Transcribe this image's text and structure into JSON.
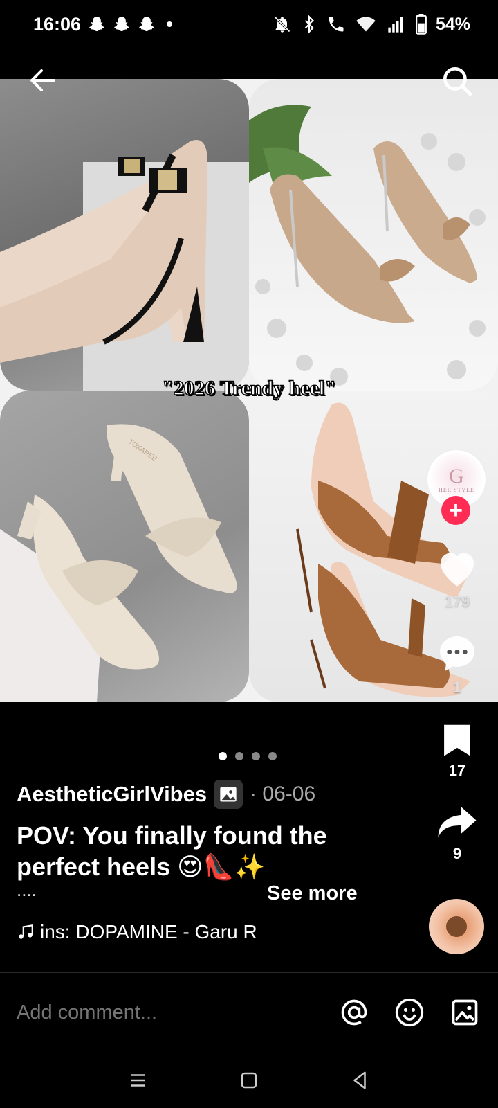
{
  "status_bar": {
    "time": "16:06",
    "battery": "54%",
    "icons": [
      "snapchat-ghost-icon",
      "snapchat-ghost-icon",
      "snapchat-ghost-icon",
      "dot-icon",
      "mute-icon",
      "bluetooth-icon",
      "wifi-calling-icon",
      "wifi-icon",
      "signal-icon",
      "battery-icon"
    ]
  },
  "top_nav": {
    "back_icon": "back-arrow-icon",
    "search_icon": "search-icon"
  },
  "post": {
    "collage_caption": "\"2026 Trendy heel\"",
    "creator_avatar": {
      "letter": "G",
      "sub": "HER STYLE"
    },
    "follow_symbol": "+",
    "likes": "179",
    "comments": "1",
    "bookmarks": "17",
    "shares": "9",
    "pagination": {
      "count": 4,
      "active": 0
    },
    "author": "AestheticGirlVibes",
    "date": "· 06-06",
    "caption": "POV: You finally found the perfect heels 😍👠✨",
    "ellipsis": "....",
    "see_more": "See more",
    "music": "ins: DOPAMINE - Garu R"
  },
  "comment_bar": {
    "placeholder": "Add comment...",
    "icons": [
      "mention-icon",
      "emoji-icon",
      "image-icon"
    ]
  },
  "nav_bar": {
    "icons": [
      "recents-icon",
      "home-icon",
      "back-icon"
    ]
  },
  "colors": {
    "background": "#000000",
    "follow": "#fe2c55",
    "text": "#ffffff",
    "muted": "#aaaaaa"
  }
}
